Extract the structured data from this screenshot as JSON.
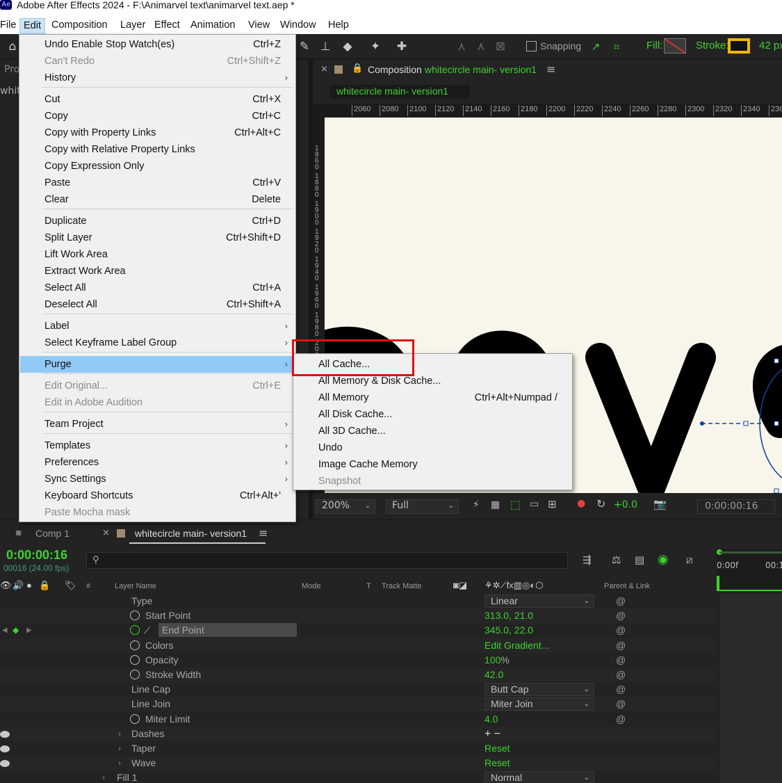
{
  "window": {
    "title": "Adobe After Effects 2024 - F:\\Animarvel text\\animarvel text.aep *",
    "logo": "Ae"
  },
  "menubar": [
    "File",
    "Edit",
    "Composition",
    "Layer",
    "Effect",
    "Animation",
    "View",
    "Window",
    "Help"
  ],
  "toolbar": {
    "snapping": "Snapping",
    "fill": "Fill:",
    "stroke": "Stroke:",
    "stroke_px": "42 px"
  },
  "project_panel": {
    "tab_partial": "Pro",
    "item_partial": "whit"
  },
  "comp_panel": {
    "tab_prefix": "Composition",
    "tab_name": "whitecircle main- version1",
    "subtab": "whitecircle main- version1",
    "ruler_h": [
      "2060",
      "2080",
      "2100",
      "2120",
      "2140",
      "2160",
      "2180",
      "2200",
      "2220",
      "2240",
      "2260",
      "2280",
      "2300",
      "2320",
      "2340",
      "236"
    ],
    "ruler_v": [
      "1860",
      "1880",
      "1900",
      "1920",
      "1940",
      "1960",
      "1980",
      "200"
    ],
    "artwork_text": "arve",
    "zoom": "200%",
    "resolution": "Full",
    "exposure": "+0.0",
    "timecode": "0:00:00:16"
  },
  "edit_menu": {
    "items": [
      {
        "label": "Undo Enable Stop Watch(es)",
        "shortcut": "Ctrl+Z"
      },
      {
        "label": "Can't Redo",
        "shortcut": "Ctrl+Shift+Z",
        "disabled": true
      },
      {
        "label": "History",
        "submenu": true
      },
      {
        "label": "Cut",
        "shortcut": "Ctrl+X"
      },
      {
        "label": "Copy",
        "shortcut": "Ctrl+C"
      },
      {
        "label": "Copy with Property Links",
        "shortcut": "Ctrl+Alt+C"
      },
      {
        "label": "Copy with Relative Property Links"
      },
      {
        "label": "Copy Expression Only"
      },
      {
        "label": "Paste",
        "shortcut": "Ctrl+V"
      },
      {
        "label": "Clear",
        "shortcut": "Delete"
      },
      {
        "label": "Duplicate",
        "shortcut": "Ctrl+D"
      },
      {
        "label": "Split Layer",
        "shortcut": "Ctrl+Shift+D"
      },
      {
        "label": "Lift Work Area"
      },
      {
        "label": "Extract Work Area"
      },
      {
        "label": "Select All",
        "shortcut": "Ctrl+A"
      },
      {
        "label": "Deselect All",
        "shortcut": "Ctrl+Shift+A"
      },
      {
        "label": "Label",
        "submenu": true
      },
      {
        "label": "Select Keyframe Label Group",
        "submenu": true
      },
      {
        "label": "Purge",
        "submenu": true,
        "highlighted": true
      },
      {
        "label": "Edit Original...",
        "shortcut": "Ctrl+E",
        "disabled": true
      },
      {
        "label": "Edit in Adobe Audition",
        "disabled": true
      },
      {
        "label": "Team Project",
        "submenu": true
      },
      {
        "label": "Templates",
        "submenu": true
      },
      {
        "label": "Preferences",
        "submenu": true
      },
      {
        "label": "Sync Settings",
        "submenu": true
      },
      {
        "label": "Keyboard Shortcuts",
        "shortcut": "Ctrl+Alt+'"
      },
      {
        "label": "Paste Mocha mask",
        "disabled": true
      }
    ]
  },
  "purge_menu": {
    "items": [
      {
        "label": "All Cache..."
      },
      {
        "label": "All Memory & Disk Cache..."
      },
      {
        "label": "All Memory",
        "shortcut": "Ctrl+Alt+Numpad /"
      },
      {
        "label": "All Disk Cache..."
      },
      {
        "label": "All 3D Cache..."
      },
      {
        "label": "Undo"
      },
      {
        "label": "Image Cache Memory"
      },
      {
        "label": "Snapshot",
        "disabled": true
      }
    ],
    "highlight_color": "#e01010"
  },
  "timeline": {
    "tab_comp1": "Comp 1",
    "tab_active": "whitecircle main- version1",
    "timecode": "0:00:00:16",
    "frame_info": "00016 (24.00 fps)",
    "search_placeholder": "",
    "columns": {
      "hash": "#",
      "layer_name": "Layer Name",
      "mode": "Mode",
      "t": "T",
      "track_matte": "Track Matte",
      "parent": "Parent & Link"
    },
    "ruler": [
      "0:00f",
      "00:1"
    ],
    "rows": [
      {
        "name": "Type",
        "value": "Linear",
        "kind": "select",
        "stopwatch": false
      },
      {
        "name": "Start Point",
        "value": "313.0, 21.0",
        "kind": "value",
        "stopwatch": true
      },
      {
        "name": "End Point",
        "value": "345.0, 22.0",
        "kind": "value",
        "stopwatch": true,
        "selected": true
      },
      {
        "name": "Colors",
        "value": "Edit Gradient...",
        "kind": "value",
        "stopwatch": true
      },
      {
        "name": "Opacity",
        "value": "100",
        "unit": "%",
        "kind": "value",
        "stopwatch": true
      },
      {
        "name": "Stroke Width",
        "value": "42.0",
        "kind": "value",
        "stopwatch": true
      },
      {
        "name": "Line Cap",
        "value": "Butt Cap",
        "kind": "select",
        "stopwatch": false
      },
      {
        "name": "Line Join",
        "value": "Miter Join",
        "kind": "select",
        "stopwatch": false
      },
      {
        "name": "Miter Limit",
        "value": "4.0",
        "kind": "value",
        "stopwatch": true
      },
      {
        "name": "Dashes",
        "value": "+ −",
        "kind": "addremove",
        "stopwatch": false,
        "twirl": true
      },
      {
        "name": "Taper",
        "value": "Reset",
        "kind": "value",
        "stopwatch": false,
        "twirl": true
      },
      {
        "name": "Wave",
        "value": "Reset",
        "kind": "value",
        "stopwatch": false,
        "twirl": true
      },
      {
        "name": "Fill 1",
        "value": "Normal",
        "kind": "select",
        "stopwatch": false,
        "twirl": true
      }
    ]
  },
  "colors": {
    "accent_green": "#3fd22e",
    "menu_highlight": "#91c9f7",
    "canvas": "#f8f6ea",
    "stroke_yellow": "#f0b800"
  }
}
